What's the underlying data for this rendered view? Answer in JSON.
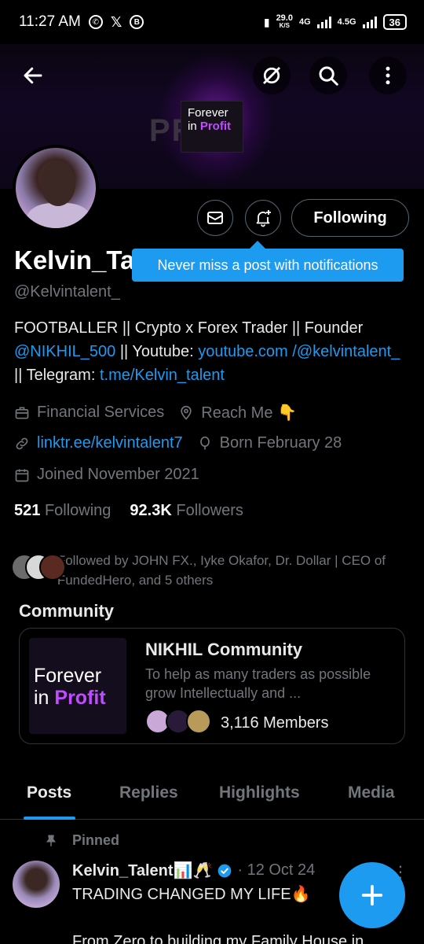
{
  "status_bar": {
    "time": "11:27 AM",
    "speed_value": "29.0",
    "speed_unit": "K/S",
    "net1": "4G",
    "net2": "4.5G",
    "battery": "36"
  },
  "banner": {
    "background_word": "PR    IT",
    "logo_line1": "Forever",
    "logo_line2_a": "in ",
    "logo_line2_b": "Profit"
  },
  "profile": {
    "display_name": "Kelvin_Tal",
    "handle": "@Kelvintalent_",
    "bio_text_1": "FOOTBALLER || Crypto x Forex Trader || Founder ",
    "bio_link_1": "@NIKHIL_500",
    "bio_text_2": " || Youtube: ",
    "bio_link_2": "youtube.com /@kelvintalent_",
    "bio_text_3": " || Telegram: ",
    "bio_link_3": "t.me/Kelvin_talent",
    "category": "Financial Services",
    "location": "Reach Me 👇",
    "website": "linktr.ee/kelvintalent7",
    "birthday": "Born February 28",
    "joined": "Joined November 2021",
    "following_count": "521",
    "following_label": "Following",
    "followers_count": "92.3K",
    "followers_label": "Followers",
    "followed_by": "Followed by JOHN FX., Iyke Okafor, Dr. Dollar | CEO of FundedHero, and 5 others"
  },
  "actions": {
    "following_button": "Following",
    "tooltip": "Never miss a post with notifications"
  },
  "community": {
    "heading": "Community",
    "title": "NIKHIL Community",
    "description": "To help as many traders as possible grow Intellectually and ...",
    "members": "3,116 Members",
    "logo_line1": "Forever",
    "logo_line2_a": "in ",
    "logo_line2_b": "Profit"
  },
  "tabs": [
    "Posts",
    "Replies",
    "Highlights",
    "Media"
  ],
  "post": {
    "pinned_label": "Pinned",
    "author": "Kelvin_Talent📊🥂",
    "dot_date": "· 12 Oct 24",
    "more": "⋮",
    "line1": "TRADING CHANGED MY LIFE🔥",
    "line2": "From Zero to building my Family House in"
  },
  "colors": {
    "accent": "#1d9bf0",
    "brand_purple": "#c14cff",
    "muted": "#71767b"
  },
  "icons": [
    "back-arrow-icon",
    "grok-icon",
    "search-icon",
    "more-vertical-icon",
    "mail-icon",
    "bell-plus-icon",
    "briefcase-icon",
    "location-icon",
    "link-icon",
    "balloon-icon",
    "calendar-icon",
    "pin-icon",
    "verified-badge-icon",
    "plus-icon"
  ]
}
